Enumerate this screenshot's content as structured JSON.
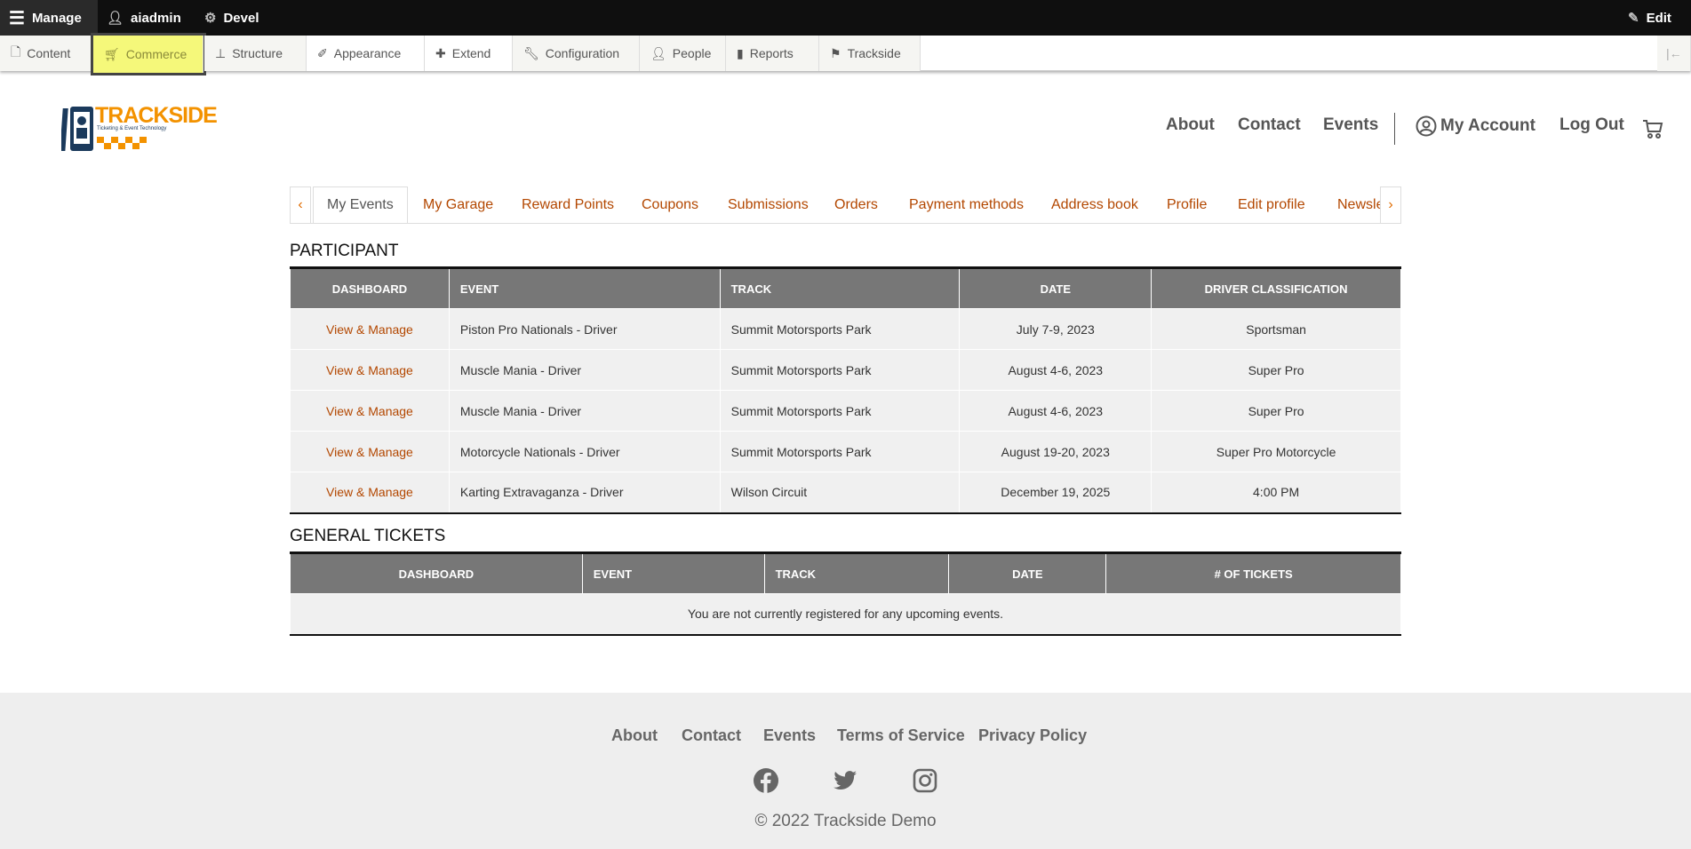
{
  "toolbar": {
    "manage": "Manage",
    "user": "aiadmin",
    "devel": "Devel",
    "edit": "Edit",
    "tray": [
      "Content",
      "Commerce",
      "Structure",
      "Appearance",
      "Extend",
      "Configuration",
      "People",
      "Reports",
      "Trackside"
    ]
  },
  "site": {
    "logo_text": "TRACKSIDE",
    "logo_tagline": "Ticketing & Event Technology",
    "nav": {
      "about": "About",
      "contact": "Contact",
      "events": "Events",
      "account": "My Account",
      "logout": "Log Out"
    }
  },
  "tabs": [
    "My Events",
    "My Garage",
    "Reward Points",
    "Coupons",
    "Submissions",
    "Orders",
    "Payment methods",
    "Address book",
    "Profile",
    "Edit profile",
    "Newsle"
  ],
  "participant": {
    "title": "PARTICIPANT",
    "headers": [
      "DASHBOARD",
      "EVENT",
      "TRACK",
      "DATE",
      "DRIVER CLASSIFICATION"
    ],
    "rows": [
      [
        "View & Manage",
        "Piston Pro Nationals - Driver",
        "Summit Motorsports Park",
        "July 7-9, 2023",
        "Sportsman"
      ],
      [
        "View & Manage",
        "Muscle Mania - Driver",
        "Summit Motorsports Park",
        "August 4-6, 2023",
        "Super Pro"
      ],
      [
        "View & Manage",
        "Muscle Mania - Driver",
        "Summit Motorsports Park",
        "August 4-6, 2023",
        "Super Pro"
      ],
      [
        "View & Manage",
        "Motorcycle Nationals - Driver",
        "Summit Motorsports Park",
        "August 19-20, 2023",
        "Super Pro Motorcycle"
      ],
      [
        "View & Manage",
        "Karting Extravaganza - Driver",
        "Wilson Circuit",
        "December 19, 2025",
        "4:00 PM"
      ]
    ]
  },
  "general": {
    "title": "GENERAL TICKETS",
    "headers": [
      "DASHBOARD",
      "EVENT",
      "TRACK",
      "DATE",
      "# OF TICKETS"
    ],
    "empty": "You are not currently registered for any upcoming events."
  },
  "footer": {
    "links": [
      "About",
      "Contact",
      "Events",
      "Terms of Service",
      "Privacy Policy"
    ],
    "copyright": "© 2022 Trackside Demo"
  },
  "colors": {
    "link": "#b34700",
    "header_bg": "#777777",
    "accent": "#f39200",
    "brand_navy": "#1b3a5c"
  }
}
